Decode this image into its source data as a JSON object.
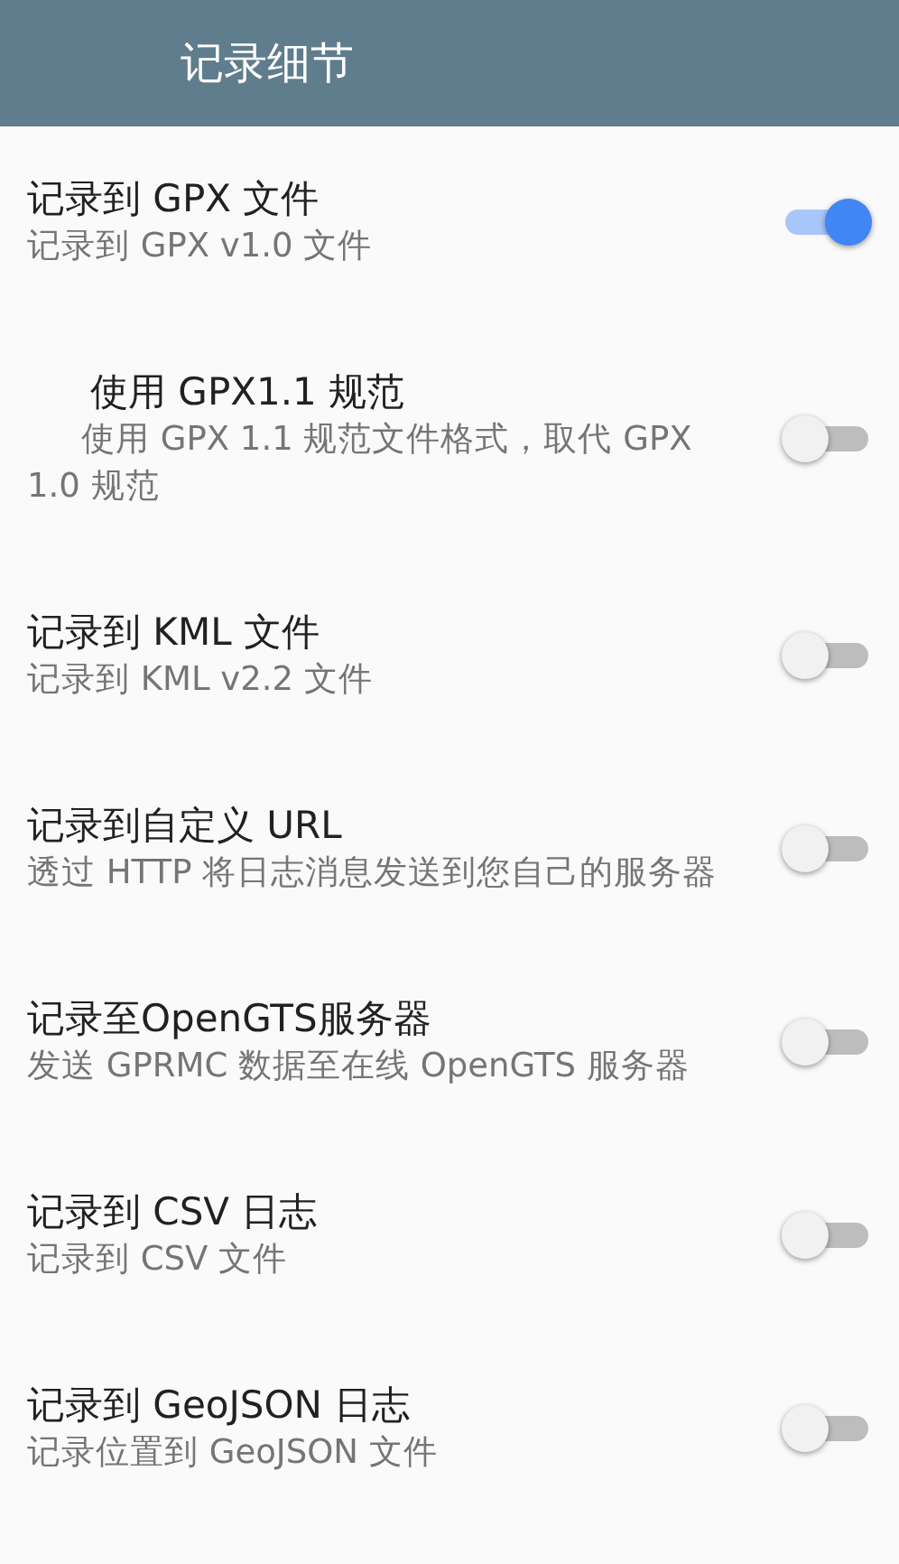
{
  "app_bar": {
    "title": "记录细节"
  },
  "settings": [
    {
      "title": "记录到 GPX 文件",
      "summary": "记录到 GPX v1.0 文件",
      "on": true,
      "indented": false
    },
    {
      "title": "使用 GPX1.1 规范",
      "summary": "使用 GPX 1.1 规范文件格式，取代 GPX 1.0 规范",
      "on": false,
      "indented": true
    },
    {
      "title": "记录到 KML 文件",
      "summary": "记录到 KML v2.2 文件",
      "on": false,
      "indented": false
    },
    {
      "title": "记录到自定义 URL",
      "summary": "透过 HTTP 将日志消息发送到您自己的服务器",
      "on": false,
      "indented": false
    },
    {
      "title": "记录至OpenGTS服务器",
      "summary": "发送 GPRMC 数据至在线 OpenGTS 服务器",
      "on": false,
      "indented": false
    },
    {
      "title": "记录到 CSV 日志",
      "summary": "记录到 CSV 文件",
      "on": false,
      "indented": false
    },
    {
      "title": "记录到 GeoJSON 日志",
      "summary": "记录位置到 GeoJSON 文件",
      "on": false,
      "indented": false
    }
  ]
}
